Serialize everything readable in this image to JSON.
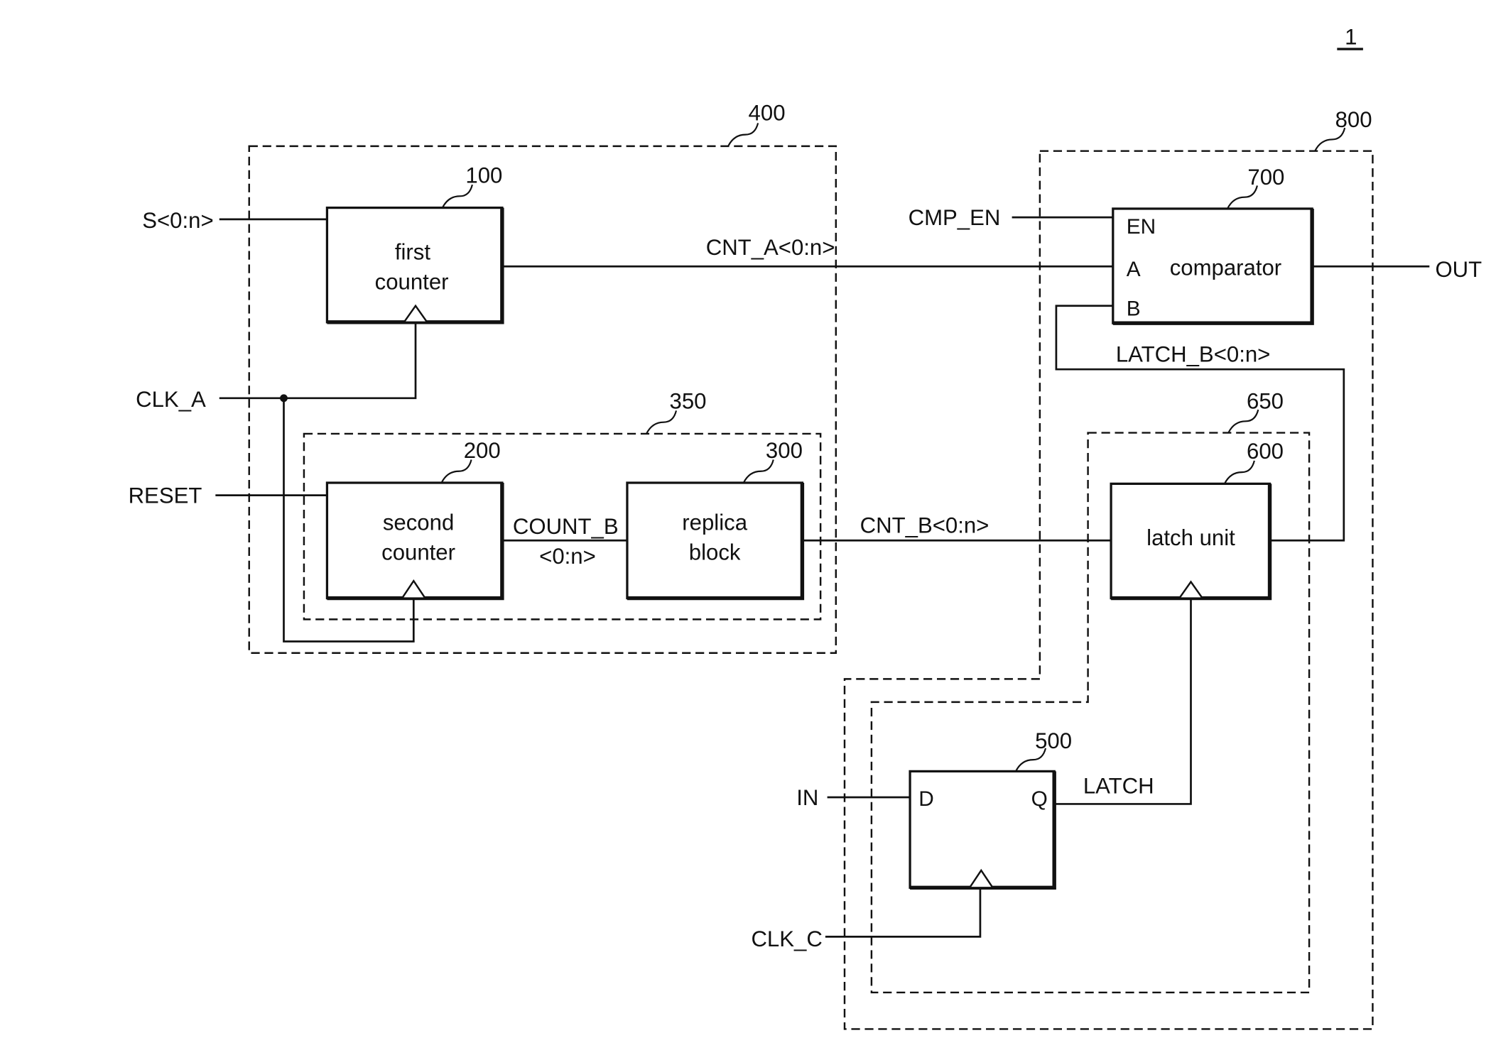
{
  "figure": {
    "figure_number": "1",
    "blocks": {
      "first_counter": {
        "ref": "100",
        "line1": "first",
        "line2": "counter"
      },
      "second_counter": {
        "ref": "200",
        "line1": "second",
        "line2": "counter"
      },
      "replica_block": {
        "ref": "300",
        "line1": "replica",
        "line2": "block"
      },
      "flip_flop": {
        "ref": "500",
        "port_d": "D",
        "port_q": "Q"
      },
      "latch_unit": {
        "ref": "600",
        "label": "latch unit"
      },
      "comparator": {
        "ref": "700",
        "label": "comparator",
        "port_en": "EN",
        "port_a": "A",
        "port_b": "B"
      }
    },
    "groups": {
      "g350": {
        "ref": "350"
      },
      "g400": {
        "ref": "400"
      },
      "g650": {
        "ref": "650"
      },
      "g800": {
        "ref": "800"
      }
    },
    "signals": {
      "s": "S<0:n>",
      "clk_a": "CLK_A",
      "reset": "RESET",
      "count_b_1": "COUNT_B",
      "count_b_2": "<0:n>",
      "cnt_a": "CNT_A<0:n>",
      "cnt_b": "CNT_B<0:n>",
      "cmp_en": "CMP_EN",
      "out": "OUT",
      "latch_b": "LATCH_B<0:n>",
      "in": "IN",
      "latch": "LATCH",
      "clk_c": "CLK_C"
    }
  }
}
